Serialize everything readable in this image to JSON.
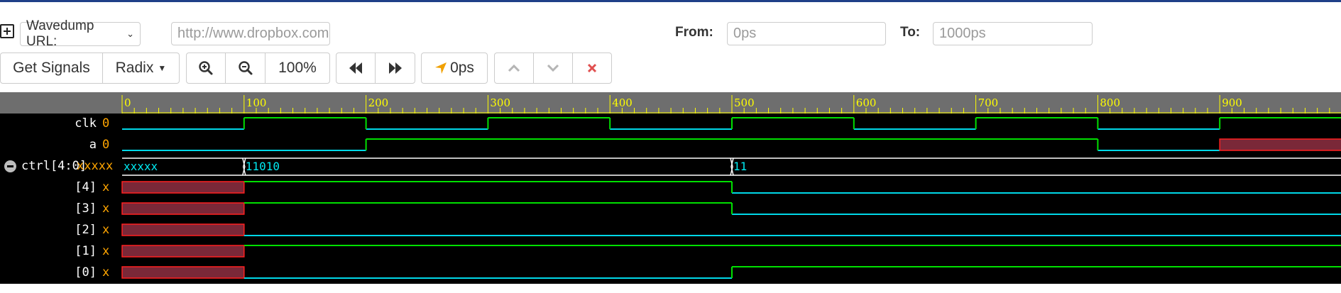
{
  "toolbar_top": {
    "add_icon": "plus-square-icon",
    "wavedump_select": "Wavedump URL:",
    "url_placeholder": "http://www.dropbox.com",
    "from_label": "From:",
    "from_placeholder": "0ps",
    "to_label": "To:",
    "to_placeholder": "1000ps"
  },
  "toolbar": {
    "get_signals": "Get Signals",
    "radix": "Radix",
    "zoom_in_icon": "zoom-in-icon",
    "zoom_out_icon": "zoom-out-icon",
    "zoom_level": "100%",
    "prev_edge_icon": "fast-backward-icon",
    "next_edge_icon": "fast-forward-icon",
    "cursor_time": "0ps",
    "cursor_icon": "location-arrow-icon",
    "up_icon": "chevron-up-icon",
    "down_icon": "chevron-down-icon",
    "remove_icon": "close-icon"
  },
  "colors": {
    "wave_high": "#00e000",
    "wave_low": "#00d8e8",
    "undefined_fill": "#7a2838",
    "undefined_edge": "#ff2020",
    "ruler_text": "#ffff00",
    "bus_text": "#00e8f0",
    "value_text": "#ffa500",
    "remove_red": "#e05050"
  },
  "ruler": {
    "labels": [
      "0",
      "100",
      "200",
      "300",
      "400",
      "500",
      "600",
      "700",
      "800",
      "900"
    ],
    "max_time": 1000
  },
  "signals": [
    {
      "name": "clk",
      "value": "0",
      "kind": "bit",
      "segments": [
        [
          0,
          100,
          "0"
        ],
        [
          100,
          200,
          "1"
        ],
        [
          200,
          300,
          "0"
        ],
        [
          300,
          400,
          "1"
        ],
        [
          400,
          500,
          "0"
        ],
        [
          500,
          600,
          "1"
        ],
        [
          600,
          700,
          "0"
        ],
        [
          700,
          800,
          "1"
        ],
        [
          800,
          900,
          "0"
        ],
        [
          900,
          1000,
          "1"
        ]
      ]
    },
    {
      "name": "a",
      "value": "0",
      "kind": "bit",
      "segments": [
        [
          0,
          200,
          "0"
        ],
        [
          200,
          800,
          "1"
        ],
        [
          800,
          900,
          "0"
        ],
        [
          900,
          1000,
          "x"
        ]
      ]
    },
    {
      "name": "ctrl[4:0]",
      "value": "xxxxx",
      "kind": "bus",
      "collapse_icon": "minus-circle-icon",
      "segments": [
        [
          0,
          100,
          "xxxxx"
        ],
        [
          100,
          500,
          "11010"
        ],
        [
          500,
          1000,
          "11"
        ]
      ]
    },
    {
      "name": "[4]",
      "value": "x",
      "kind": "bit",
      "segments": [
        [
          0,
          100,
          "x"
        ],
        [
          100,
          500,
          "1"
        ],
        [
          500,
          1000,
          "0"
        ]
      ]
    },
    {
      "name": "[3]",
      "value": "x",
      "kind": "bit",
      "segments": [
        [
          0,
          100,
          "x"
        ],
        [
          100,
          500,
          "1"
        ],
        [
          500,
          1000,
          "0"
        ]
      ]
    },
    {
      "name": "[2]",
      "value": "x",
      "kind": "bit",
      "segments": [
        [
          0,
          100,
          "x"
        ],
        [
          100,
          1000,
          "0"
        ]
      ]
    },
    {
      "name": "[1]",
      "value": "x",
      "kind": "bit",
      "segments": [
        [
          0,
          100,
          "x"
        ],
        [
          100,
          1000,
          "1"
        ]
      ]
    },
    {
      "name": "[0]",
      "value": "x",
      "kind": "bit",
      "segments": [
        [
          0,
          100,
          "x"
        ],
        [
          100,
          500,
          "0"
        ],
        [
          500,
          1000,
          "1"
        ]
      ]
    }
  ]
}
